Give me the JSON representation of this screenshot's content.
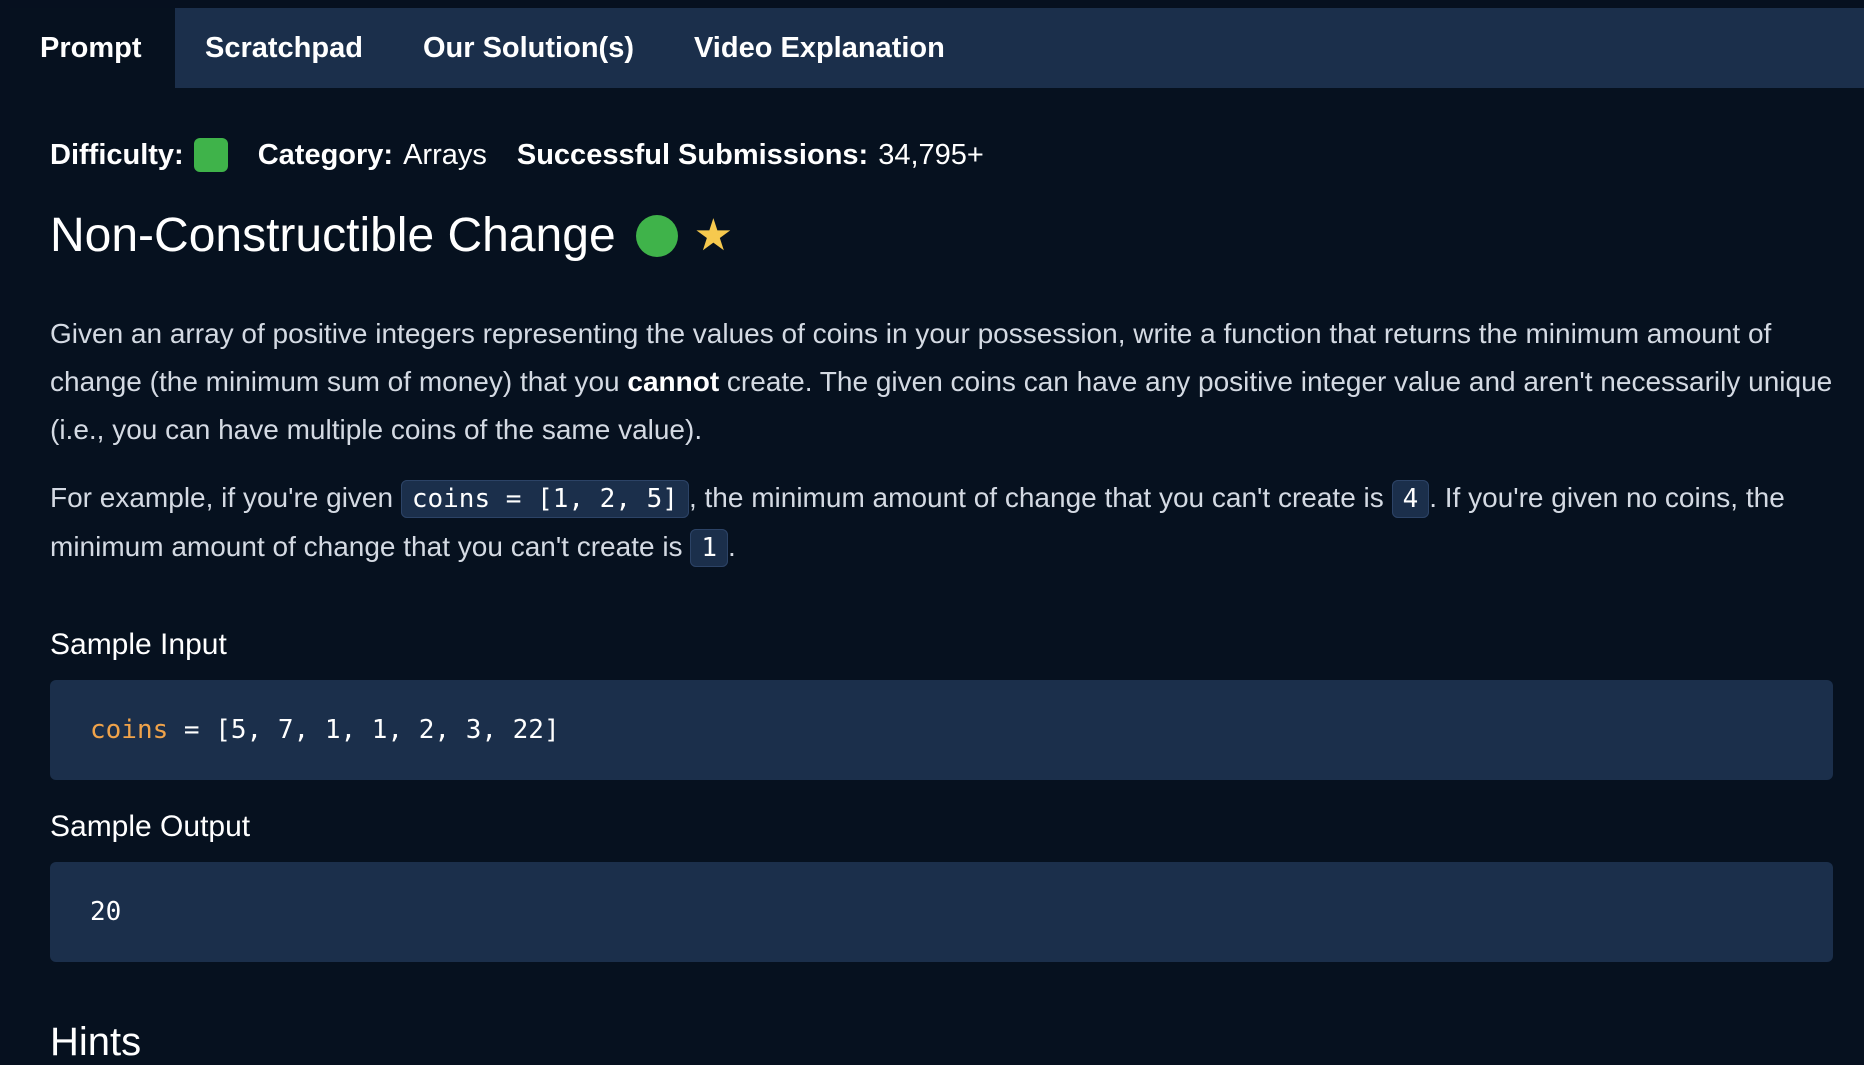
{
  "tabs": [
    {
      "label": "Prompt",
      "active": true
    },
    {
      "label": "Scratchpad",
      "active": false
    },
    {
      "label": "Our Solution(s)",
      "active": false
    },
    {
      "label": "Video Explanation",
      "active": false
    }
  ],
  "meta": {
    "difficulty_label": "Difficulty:",
    "difficulty_color": "#3fb34a",
    "category_label": "Category:",
    "category_value": "Arrays",
    "submissions_label": "Successful Submissions:",
    "submissions_value": "34,795+"
  },
  "problem": {
    "title": "Non-Constructible Change",
    "status_icon": "green-dot-icon",
    "star_icon": "star-icon",
    "para1_a": "Given an array of positive integers representing the values of coins in your possession, write a function that returns the minimum amount of change (the minimum sum of money) that you ",
    "para1_bold": "cannot",
    "para1_b": " create. The given coins can have any positive integer value and aren't necessarily unique (i.e., you can have multiple coins of the same value).",
    "para2_a": "For example, if you're given ",
    "para2_code1": "coins = [1, 2, 5]",
    "para2_b": ", the minimum amount of change that you can't create is ",
    "para2_code2": "4",
    "para2_c": ". If you're given no coins, the minimum amount of change that you can't create is ",
    "para2_code3": "1",
    "para2_d": "."
  },
  "sample_input": {
    "heading": "Sample Input",
    "var": "coins",
    "rest": " = [5, 7, 1, 1, 2, 3, 22]"
  },
  "sample_output": {
    "heading": "Sample Output",
    "value": "20"
  },
  "hints": {
    "heading": "Hints"
  }
}
